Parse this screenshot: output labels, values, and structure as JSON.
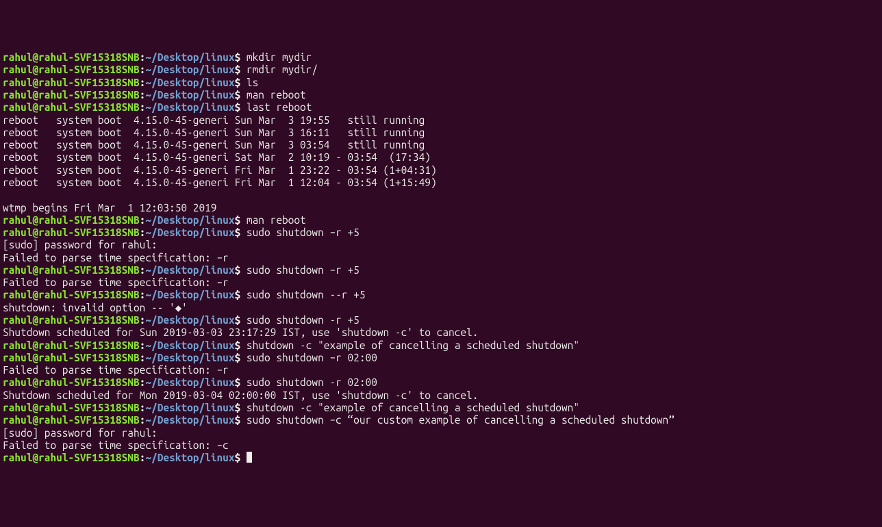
{
  "prompt": {
    "user": "rahul",
    "at": "@",
    "host": "rahul-SVF15318SNB",
    "colon": ":",
    "path": "~/Desktop/linux",
    "dollar": "$ "
  },
  "lines": [
    {
      "type": "cmd",
      "text": "mkdir mydir"
    },
    {
      "type": "cmd",
      "text": "rmdir mydir/"
    },
    {
      "type": "cmd",
      "text": "ls"
    },
    {
      "type": "cmd",
      "text": "man reboot"
    },
    {
      "type": "cmd",
      "text": "last reboot"
    },
    {
      "type": "out",
      "text": "reboot   system boot  4.15.0-45-generi Sun Mar  3 19:55   still running"
    },
    {
      "type": "out",
      "text": "reboot   system boot  4.15.0-45-generi Sun Mar  3 16:11   still running"
    },
    {
      "type": "out",
      "text": "reboot   system boot  4.15.0-45-generi Sun Mar  3 03:54   still running"
    },
    {
      "type": "out",
      "text": "reboot   system boot  4.15.0-45-generi Sat Mar  2 10:19 - 03:54  (17:34)"
    },
    {
      "type": "out",
      "text": "reboot   system boot  4.15.0-45-generi Fri Mar  1 23:22 - 03:54 (1+04:31)"
    },
    {
      "type": "out",
      "text": "reboot   system boot  4.15.0-45-generi Fri Mar  1 12:04 - 03:54 (1+15:49)"
    },
    {
      "type": "blank"
    },
    {
      "type": "out",
      "text": "wtmp begins Fri Mar  1 12:03:50 2019"
    },
    {
      "type": "cmd",
      "text": "man reboot"
    },
    {
      "type": "cmd",
      "text": "sudo shutdown –r +5"
    },
    {
      "type": "out",
      "text": "[sudo] password for rahul: "
    },
    {
      "type": "out",
      "text": "Failed to parse time specification: –r"
    },
    {
      "type": "cmd",
      "text": "sudo shutdown –r +5"
    },
    {
      "type": "out",
      "text": "Failed to parse time specification: –r"
    },
    {
      "type": "cmd",
      "text": "sudo shutdown --r +5"
    },
    {
      "type": "out",
      "text": "shutdown: invalid option -- '◆'"
    },
    {
      "type": "cmd",
      "text": "sudo shutdown -r +5"
    },
    {
      "type": "out",
      "text": "Shutdown scheduled for Sun 2019-03-03 23:17:29 IST, use 'shutdown -c' to cancel."
    },
    {
      "type": "cmd",
      "text": "shutdown -c \"example of cancelling a scheduled shutdown\""
    },
    {
      "type": "cmd",
      "text": "sudo shutdown –r 02:00"
    },
    {
      "type": "out",
      "text": "Failed to parse time specification: –r"
    },
    {
      "type": "cmd",
      "text": "sudo shutdown -r 02:00"
    },
    {
      "type": "out",
      "text": "Shutdown scheduled for Mon 2019-03-04 02:00:00 IST, use 'shutdown -c' to cancel."
    },
    {
      "type": "cmd",
      "text": "shutdown -c \"example of cancelling a scheduled shutdown\""
    },
    {
      "type": "cmd",
      "text": "sudo shutdown –c “our custom example of cancelling a scheduled shutdown”"
    },
    {
      "type": "out",
      "text": "[sudo] password for rahul: "
    },
    {
      "type": "out",
      "text": "Failed to parse time specification: –c"
    },
    {
      "type": "cmd",
      "text": "",
      "cursor": true
    }
  ]
}
